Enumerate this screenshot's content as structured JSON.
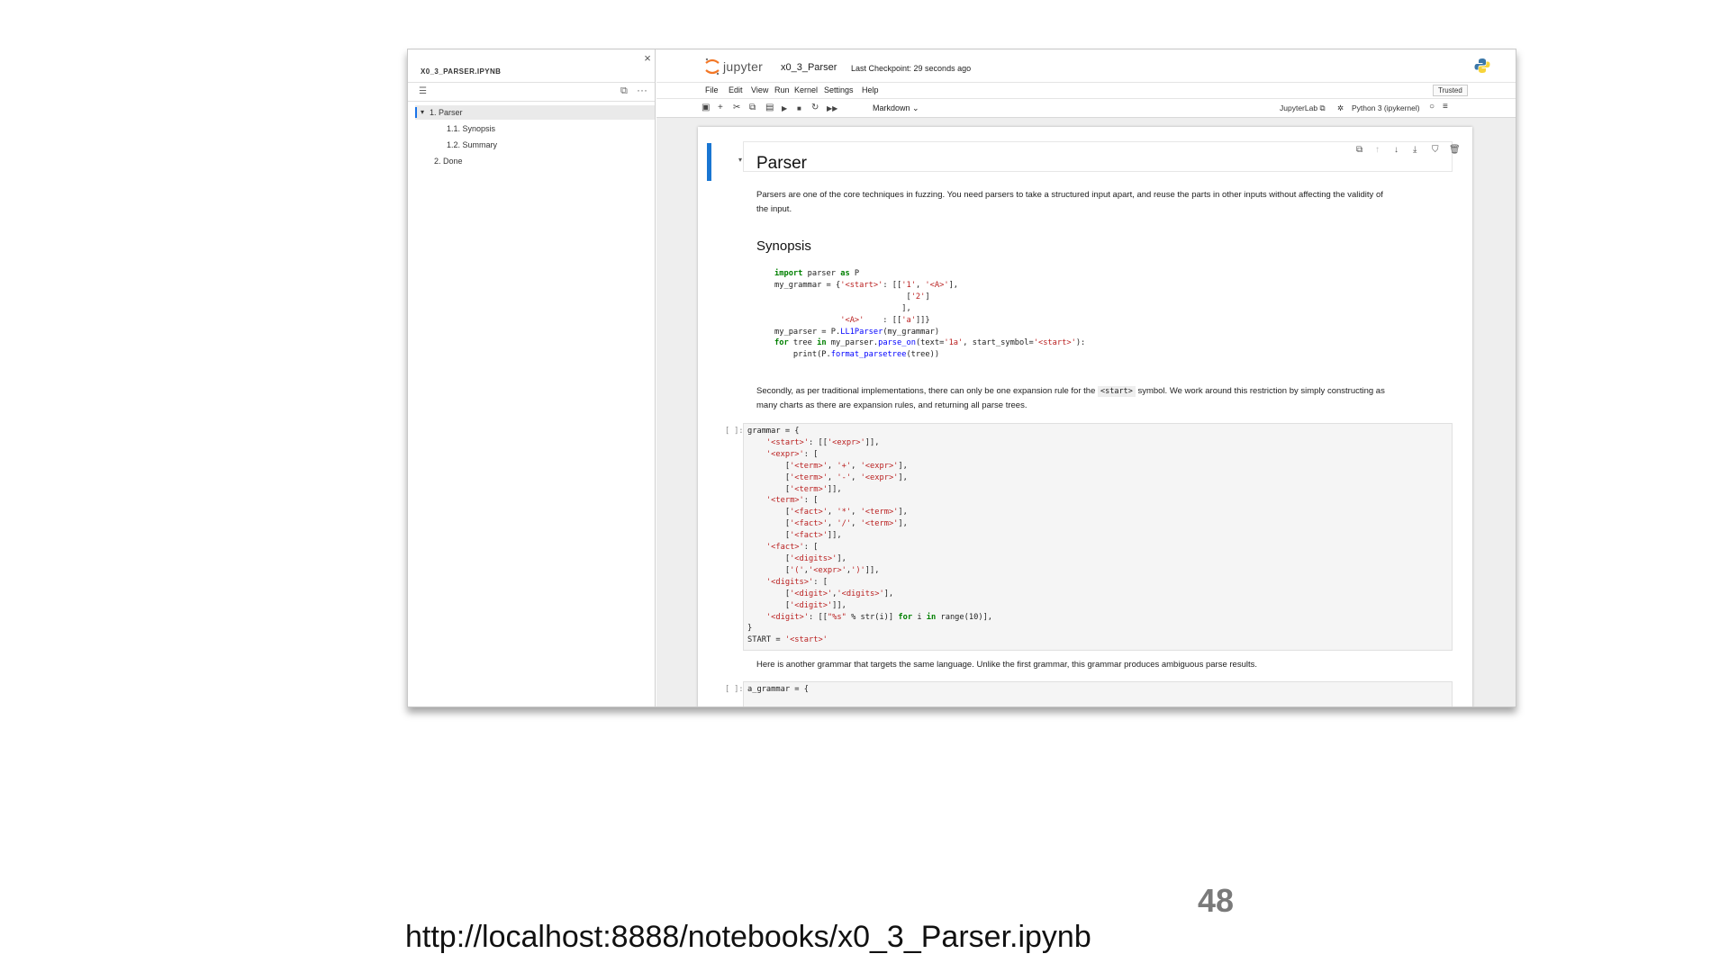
{
  "slide": {
    "page_number": "48",
    "url": "http://localhost:8888/notebooks/x0_3_Parser.ipynb"
  },
  "toc": {
    "file_title": "X0_3_PARSER.IPYNB",
    "close_glyph": "×",
    "items": [
      {
        "label": "1. Parser",
        "expanded_glyph": "▾"
      },
      {
        "label": "1.1. Synopsis"
      },
      {
        "label": "1.2. Summary"
      },
      {
        "label": "2. Done"
      }
    ]
  },
  "header": {
    "logo_text": "jupyter",
    "notebook_name": "x0_3_Parser",
    "checkpoint": "Last Checkpoint: 29 seconds ago",
    "trusted": "Trusted"
  },
  "menu": {
    "items": [
      "File",
      "Edit",
      "View",
      "Run",
      "Kernel",
      "Settings",
      "Help"
    ]
  },
  "toolbar": {
    "cell_type": "Markdown",
    "jupyterlab": "JupyterLab",
    "kernel": "Python 3 (ipykernel)",
    "icons": [
      "save-icon",
      "add-icon",
      "cut-icon",
      "copy-icon",
      "paste-icon",
      "run-icon",
      "stop-icon",
      "restart-icon",
      "fast-forward-icon"
    ]
  },
  "notebook": {
    "heading": "Parser",
    "intro_line1": "Parsers are one of the core techniques in fuzzing. You need parsers to take a structured input apart, and reuse the parts in other inputs without affecting the validity of",
    "intro_line2": "the input.",
    "synopsis_heading": "Synopsis",
    "second_para_a": "Secondly, as per traditional implementations, there can only be one expansion rule for the",
    "second_para_code": "<start>",
    "second_para_b": "symbol. We work around this restriction by simply constructing as",
    "second_para_line2": "many charts as there are expansion rules, and returning all parse trees.",
    "cell1_prompt": "[ ]:",
    "third_para": "Here is another grammar that targets the same language. Unlike the first grammar, this grammar produces ambiguous parse results.",
    "cell2_prompt": "[ ]:",
    "cell2_first_line": "a_grammar = {"
  },
  "colors": {
    "accent": "#1976d2",
    "keyword": "#008000",
    "string": "#ba2121",
    "function": "#0000ff",
    "jupyter_orange": "#f37726"
  }
}
